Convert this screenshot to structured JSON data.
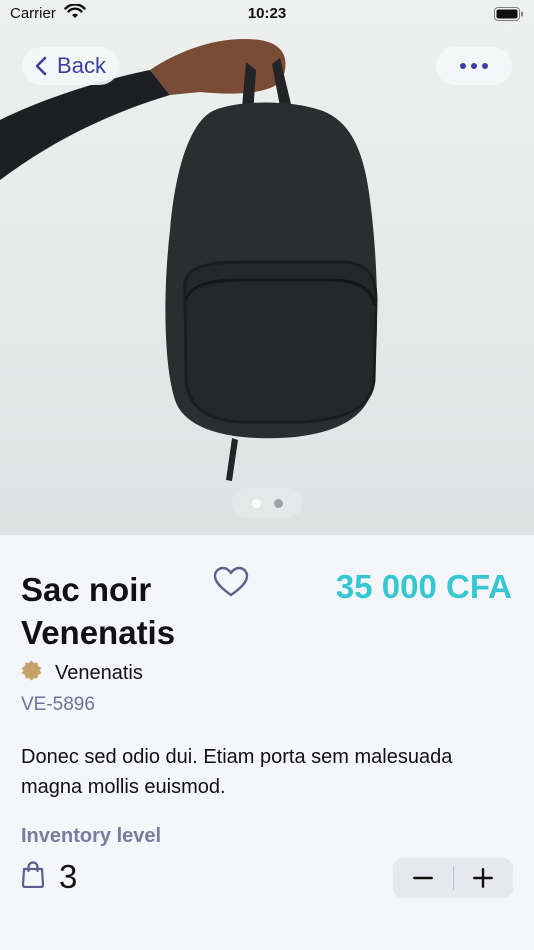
{
  "status_bar": {
    "carrier": "Carrier",
    "time": "10:23"
  },
  "nav": {
    "back_label": "Back"
  },
  "gallery": {
    "page_count": 2,
    "current_page": 1,
    "image_description_icon": "backpack-photo"
  },
  "product": {
    "title": "Sac noir Venenatis",
    "price": "35 000 CFA",
    "brand": "Venenatis",
    "sku": "VE-5896",
    "description": "Donec sed odio dui. Etiam porta sem malesuada magna mollis euismod."
  },
  "inventory": {
    "label": "Inventory level",
    "count": "3"
  },
  "colors": {
    "accent": "#3a3fa0",
    "price": "#36c7d2",
    "brand_badge": "#c8a06a",
    "label": "#7b7b9e"
  }
}
